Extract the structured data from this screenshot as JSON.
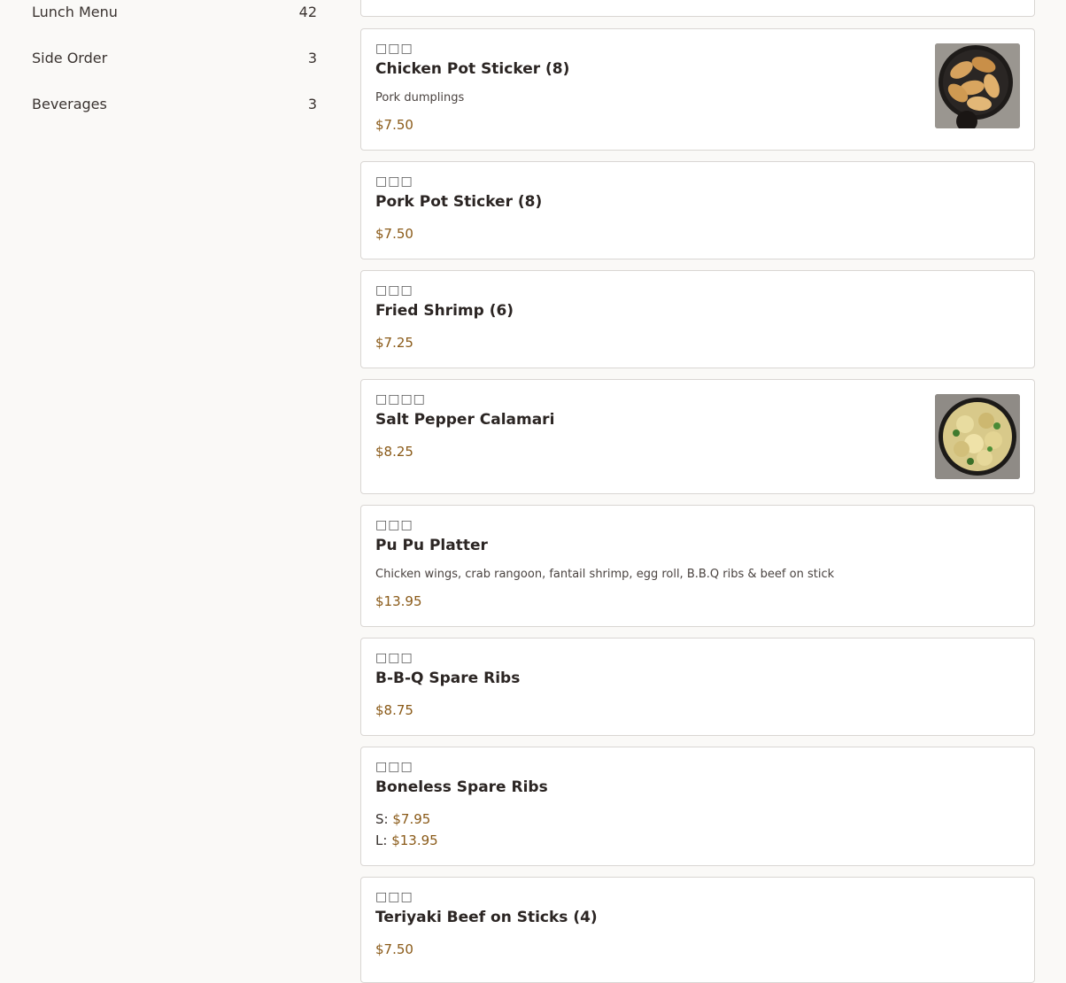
{
  "sidebar": {
    "categories": [
      {
        "label": "Lunch Menu",
        "count": "42"
      },
      {
        "label": "Side Order",
        "count": "3"
      },
      {
        "label": "Beverages",
        "count": "3"
      }
    ]
  },
  "menu": {
    "items": [
      {
        "cn": "□□□",
        "name": "Chicken Pot Sticker (8)",
        "description": "Pork dumplings",
        "price": "$7.50",
        "image": "pot-sticker-photo"
      },
      {
        "cn": "□□□",
        "name": "Pork Pot Sticker (8)",
        "price": "$7.50"
      },
      {
        "cn": "□□□",
        "name": "Fried Shrimp (6)",
        "price": "$7.25"
      },
      {
        "cn": "□□□□",
        "name": "Salt Pepper Calamari",
        "price": "$8.25",
        "image": "calamari-photo"
      },
      {
        "cn": "□□□",
        "name": "Pu Pu Platter",
        "description": "Chicken wings, crab rangoon, fantail shrimp, egg roll, B.B.Q ribs & beef on stick",
        "price": "$13.95"
      },
      {
        "cn": "□□□",
        "name": "B-B-Q Spare Ribs",
        "price": "$8.75"
      },
      {
        "cn": "□□□",
        "name": "Boneless Spare Ribs",
        "prices": [
          {
            "label": "S:",
            "value": "$7.95"
          },
          {
            "label": "L:",
            "value": "$13.95"
          }
        ]
      },
      {
        "cn": "□□□",
        "name": "Teriyaki Beef on Sticks (4)",
        "price": "$7.50"
      }
    ]
  },
  "colors": {
    "price": "#8a5a18",
    "background": "#faf9f7",
    "card_border": "#d9d6d3"
  }
}
